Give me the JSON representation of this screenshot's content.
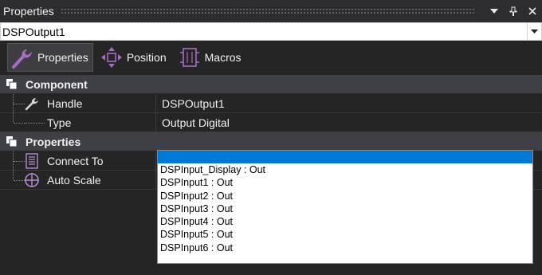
{
  "window": {
    "title": "Properties",
    "buttons": [
      "dropdown-arrow",
      "pin",
      "close"
    ]
  },
  "object_selector": {
    "value": "DSPOutput1"
  },
  "toolbar": {
    "tabs": [
      {
        "label": "Properties",
        "icon": "wrench-icon",
        "active": true
      },
      {
        "label": "Position",
        "icon": "move-arrows-icon",
        "active": false
      },
      {
        "label": "Macros",
        "icon": "macro-icon",
        "active": false
      }
    ]
  },
  "categories": [
    {
      "title": "Component",
      "rows": [
        {
          "label": "Handle",
          "value": "DSPOutput1",
          "icon": "wrench-icon"
        },
        {
          "label": "Type",
          "value": "Output Digital",
          "icon": ""
        }
      ]
    },
    {
      "title": "Properties",
      "rows": [
        {
          "label": "Connect To",
          "value": "",
          "icon": "list-icon"
        },
        {
          "label": "Auto Scale",
          "value": "",
          "icon": "crosshair-icon"
        }
      ]
    }
  ],
  "dropdown": {
    "items": [
      "",
      "DSPInput_Display : Out",
      "DSPInput1 : Out",
      "DSPInput2 : Out",
      "DSPInput3 : Out",
      "DSPInput4 : Out",
      "DSPInput5 : Out",
      "DSPInput6 : Out"
    ],
    "selected_index": 0
  },
  "colors": {
    "accent": "#9b59b6",
    "selection": "#0078d7",
    "background": "#252526",
    "category_header": "#3f3f46"
  }
}
